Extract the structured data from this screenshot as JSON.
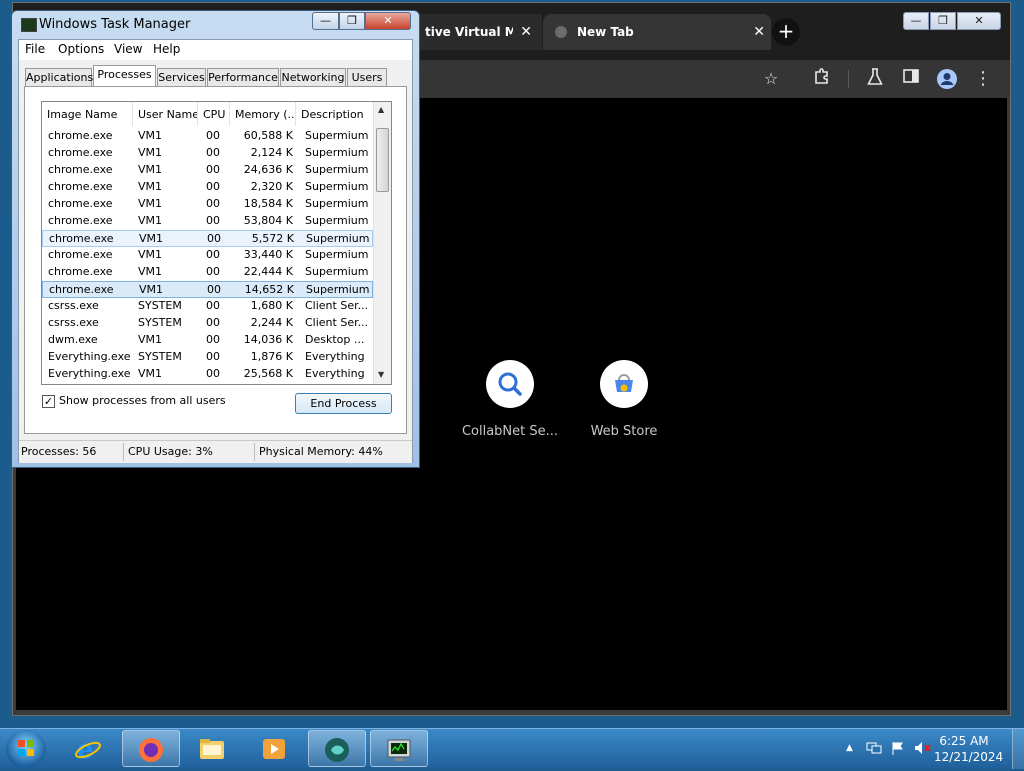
{
  "browser": {
    "tabs": [
      {
        "label": "tive Virtual M",
        "close": "✕"
      },
      {
        "label": "New Tab",
        "close": "✕"
      }
    ],
    "new_tab_symbol": "+",
    "window_buttons": {
      "minimize": "—",
      "maximize": "❐",
      "close": "✕"
    },
    "toolbar_icons": [
      "star-icon",
      "extensions-icon",
      "labs-icon",
      "side-panel-icon",
      "profile-icon",
      "menu-icon"
    ],
    "shortcuts": [
      {
        "name": "CollabNet Se...",
        "icon": "search-icon"
      },
      {
        "name": "Web Store",
        "icon": "web-store-icon"
      }
    ]
  },
  "task_manager": {
    "title": "Windows Task Manager",
    "window_buttons": {
      "minimize": "—",
      "maximize": "❐",
      "close": "✕"
    },
    "menu": [
      "File",
      "Options",
      "View",
      "Help"
    ],
    "tabs": [
      "Applications",
      "Processes",
      "Services",
      "Performance",
      "Networking",
      "Users"
    ],
    "active_tab": "Processes",
    "columns": [
      "Image Name",
      "User Name",
      "CPU",
      "Memory (...",
      "Description"
    ],
    "sort_indicator": "˄",
    "rows": [
      {
        "image": "chrome.exe",
        "user": "VM1",
        "cpu": "00",
        "mem": "60,588 K",
        "desc": "Supermium"
      },
      {
        "image": "chrome.exe",
        "user": "VM1",
        "cpu": "00",
        "mem": "2,124 K",
        "desc": "Supermium"
      },
      {
        "image": "chrome.exe",
        "user": "VM1",
        "cpu": "00",
        "mem": "24,636 K",
        "desc": "Supermium"
      },
      {
        "image": "chrome.exe",
        "user": "VM1",
        "cpu": "00",
        "mem": "2,320 K",
        "desc": "Supermium"
      },
      {
        "image": "chrome.exe",
        "user": "VM1",
        "cpu": "00",
        "mem": "18,584 K",
        "desc": "Supermium"
      },
      {
        "image": "chrome.exe",
        "user": "VM1",
        "cpu": "00",
        "mem": "53,804 K",
        "desc": "Supermium"
      },
      {
        "image": "chrome.exe",
        "user": "VM1",
        "cpu": "00",
        "mem": "5,572 K",
        "desc": "Supermium"
      },
      {
        "image": "chrome.exe",
        "user": "VM1",
        "cpu": "00",
        "mem": "33,440 K",
        "desc": "Supermium"
      },
      {
        "image": "chrome.exe",
        "user": "VM1",
        "cpu": "00",
        "mem": "22,444 K",
        "desc": "Supermium"
      },
      {
        "image": "chrome.exe",
        "user": "VM1",
        "cpu": "00",
        "mem": "14,652 K",
        "desc": "Supermium"
      },
      {
        "image": "csrss.exe",
        "user": "SYSTEM",
        "cpu": "00",
        "mem": "1,680 K",
        "desc": "Client Ser..."
      },
      {
        "image": "csrss.exe",
        "user": "SYSTEM",
        "cpu": "00",
        "mem": "2,244 K",
        "desc": "Client Ser..."
      },
      {
        "image": "dwm.exe",
        "user": "VM1",
        "cpu": "00",
        "mem": "14,036 K",
        "desc": "Desktop ..."
      },
      {
        "image": "Everything.exe",
        "user": "SYSTEM",
        "cpu": "00",
        "mem": "1,876 K",
        "desc": "Everything"
      },
      {
        "image": "Everything.exe",
        "user": "VM1",
        "cpu": "00",
        "mem": "25,568 K",
        "desc": "Everything"
      }
    ],
    "hover_row": 6,
    "selected_row": 9,
    "show_all_users": {
      "label": "Show processes from all users",
      "checked": true,
      "mark": "✓"
    },
    "end_process_label": "End Process",
    "status": {
      "processes": "Processes: 56",
      "cpu": "CPU Usage: 3%",
      "memory": "Physical Memory: 44%"
    }
  },
  "taskbar": {
    "apps": [
      "ie-icon",
      "firefox-icon",
      "explorer-icon",
      "media-player-icon",
      "remote-app-icon",
      "task-manager-icon"
    ],
    "clock": {
      "time": "6:25 AM",
      "date": "12/21/2024"
    },
    "tray_icons": [
      "show-hidden-icons-arrow",
      "network-icon",
      "action-center-flag-icon",
      "volume-muted-icon"
    ]
  },
  "colors": {
    "taskbar": "#2a71b0",
    "browser_bg": "#000000",
    "tab_strip": "#1e1e1e",
    "selection": "#dbeaf9",
    "tm_frame": "#b4cfeb"
  }
}
